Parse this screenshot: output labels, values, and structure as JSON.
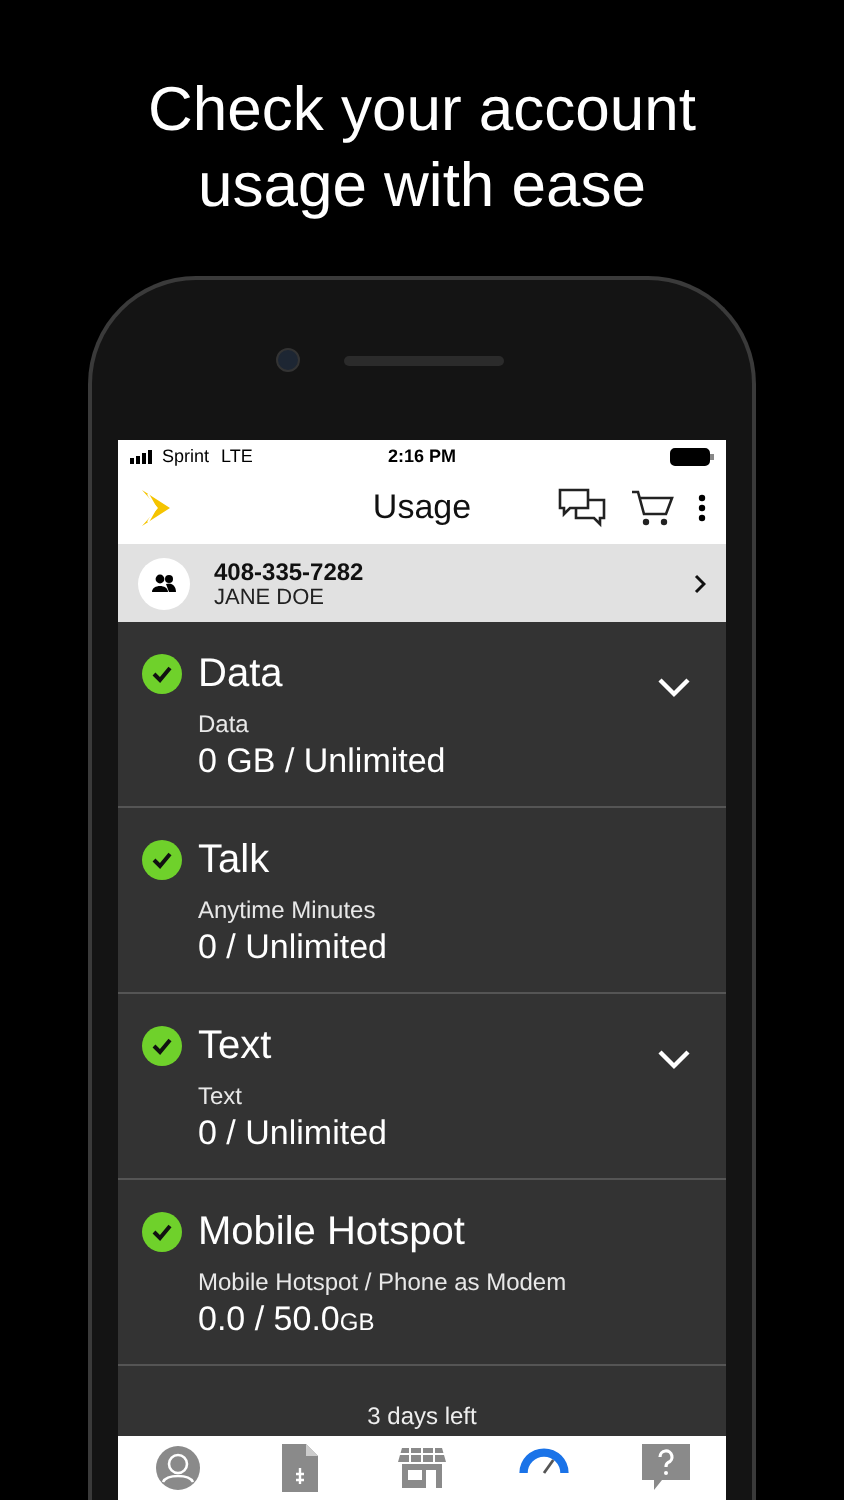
{
  "headline": "Check your account usage with ease",
  "status_bar": {
    "carrier": "Sprint",
    "network": "LTE",
    "time": "2:16 PM"
  },
  "nav": {
    "title": "Usage"
  },
  "account": {
    "number": "408-335-7282",
    "name": "JANE DOE"
  },
  "usage": [
    {
      "title": "Data",
      "ok": true,
      "expandable": true,
      "label": "Data",
      "value": "0 GB / Unlimited"
    },
    {
      "title": "Talk",
      "ok": true,
      "expandable": false,
      "label": "Anytime Minutes",
      "value": "0 / Unlimited"
    },
    {
      "title": "Text",
      "ok": true,
      "expandable": true,
      "label": "Text",
      "value": "0 / Unlimited"
    },
    {
      "title": "Mobile Hotspot",
      "ok": true,
      "expandable": false,
      "label": "Mobile Hotspot / Phone as Modem",
      "value": "0.0 / 50.0",
      "unit": "GB"
    }
  ],
  "footer": "3 days left",
  "tabs": [
    {
      "kind": "profile",
      "selected": false
    },
    {
      "kind": "bill",
      "selected": false
    },
    {
      "kind": "store",
      "selected": false
    },
    {
      "kind": "usage",
      "selected": true
    },
    {
      "kind": "help",
      "selected": false
    }
  ]
}
